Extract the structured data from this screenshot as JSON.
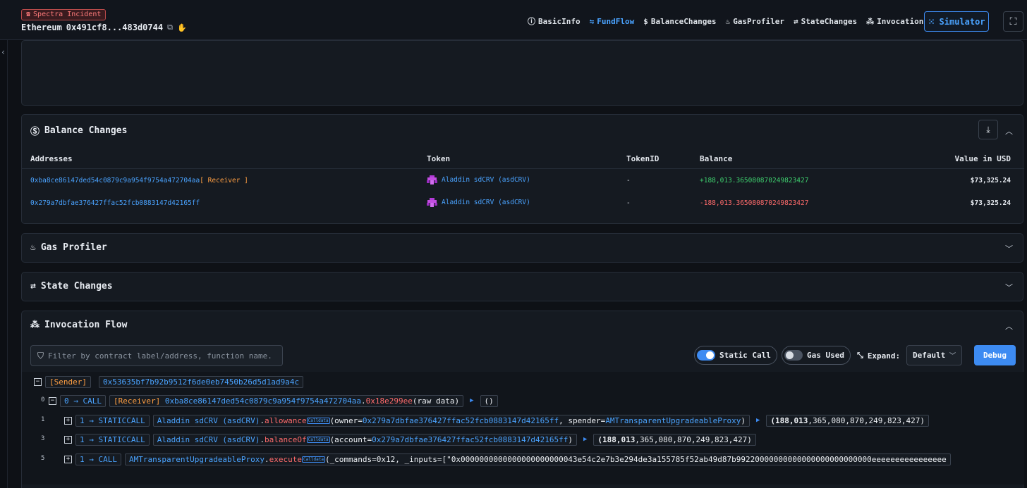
{
  "header": {
    "incident_badge": "Spectra Incident",
    "chain": "Ethereum",
    "tx_hash": "0x491cf8...483d0744",
    "nav": [
      {
        "label": "BasicInfo",
        "icon": "info-icon",
        "active": false
      },
      {
        "label": "FundFlow",
        "icon": "flow-icon",
        "active": true
      },
      {
        "label": "BalanceChanges",
        "icon": "dollar-icon",
        "active": false
      },
      {
        "label": "GasProfiler",
        "icon": "flame-icon",
        "active": false
      },
      {
        "label": "StateChanges",
        "icon": "state-icon",
        "active": false
      },
      {
        "label": "InvocationFlow",
        "icon": "tree-icon",
        "active": false
      }
    ],
    "simulator_label": "Simulator"
  },
  "balance_changes": {
    "title": "Balance Changes",
    "columns": [
      "Addresses",
      "Token",
      "TokenID",
      "Balance",
      "Value in USD"
    ],
    "rows": [
      {
        "address": "0xba8ce86147ded54c0879c9a954f9754a472704aa",
        "tag": "[ Receiver ]",
        "token": "Aladdin sdCRV (asdCRV)",
        "token_id": "-",
        "balance": "+188,013.365080870249823427",
        "usd": "$73,325.24"
      },
      {
        "address": "0x279a7dbfae376427ffac52fcb0883147d42165ff",
        "tag": "",
        "token": "Aladdin sdCRV (asdCRV)",
        "token_id": "-",
        "balance": "-188,013.365080870249823427",
        "usd": "$73,325.24"
      }
    ]
  },
  "gas_profiler": {
    "title": "Gas Profiler"
  },
  "state_changes": {
    "title": "State Changes"
  },
  "invocation_flow": {
    "title": "Invocation Flow",
    "filter_placeholder": "Filter by contract label/address, function name...",
    "static_call_label": "Static Call",
    "static_call_on": true,
    "gas_used_label": "Gas Used",
    "gas_used_on": false,
    "expand_label": "Expand:",
    "expand_value": "Default",
    "debug_label": "Debug",
    "sender_tag": "[Sender]",
    "sender_address": "0x53635bf7b92b9512f6de0eb7450b26d5d1ad9a4c",
    "calls": [
      {
        "line": "0",
        "depth_label": "0 → CALL",
        "tag": "[Receiver]",
        "target": "0xba8ce86147ded54c0879c9a954f9754a472704aa",
        "dot": ".",
        "fn": "0x18e299ee",
        "args": "(raw data)",
        "result": "()"
      },
      {
        "line": "1",
        "depth_label": "1 → STATICCALL",
        "target": "Aladdin sdCRV (asdCRV)",
        "dot": ".",
        "fn": "allowance",
        "calldata": "Calldata",
        "args_open": "(owner=",
        "arg1": "0x279a7dbfae376427ffac52fcb0883147d42165ff",
        "arg_sep": ", spender=",
        "arg2": "AMTransparentUpgradeableProxy",
        "args_close": ")",
        "result_bold": "(188,013",
        "result_rest": ",365,080,870,249,823,427)"
      },
      {
        "line": "3",
        "depth_label": "1 → STATICCALL",
        "target": "Aladdin sdCRV (asdCRV)",
        "dot": ".",
        "fn": "balanceOf",
        "calldata": "Calldata",
        "args_open": "(account=",
        "arg1": "0x279a7dbfae376427ffac52fcb0883147d42165ff",
        "args_close": ")",
        "result_bold": "(188,013",
        "result_rest": ",365,080,870,249,823,427)"
      },
      {
        "line": "5",
        "depth_label": "1 → CALL",
        "target": "AMTransparentUpgradeableProxy",
        "dot": ".",
        "fn": "execute",
        "calldata": "Calldata",
        "args": "(_commands=0x12, _inputs=[\"0x0000000000000000000000043e54c2e7b3e294de3a155785f52ab49d87b99220000000000000000000000000eeeeeeeeeeeeeeee"
      }
    ]
  }
}
